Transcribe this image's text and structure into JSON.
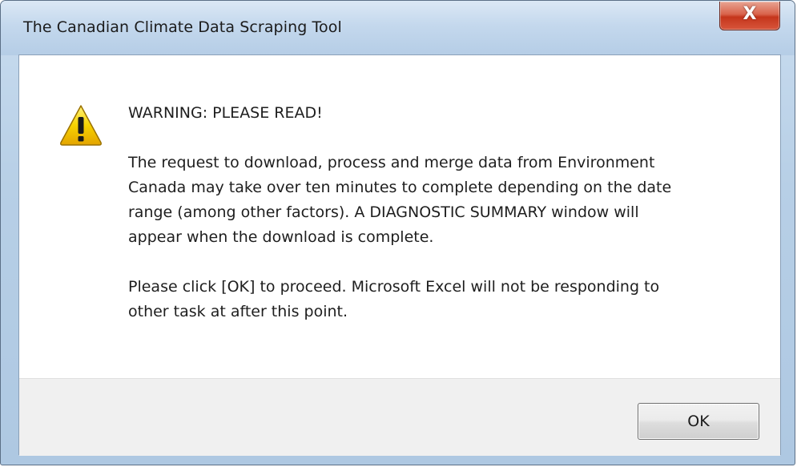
{
  "window": {
    "title": "The Canadian Climate Data Scraping Tool",
    "close_label": "X"
  },
  "dialog": {
    "icon": "warning-icon",
    "heading": "WARNING: PLEASE READ!",
    "paragraph_1_lines": [
      "The request to download, process and merge data from Environment",
      "Canada may take over ten minutes to complete depending on the date",
      "range (among other factors). A DIAGNOSTIC SUMMARY window will",
      "appear when the download is complete."
    ],
    "paragraph_2_lines": [
      "Please click [OK] to proceed. Microsoft Excel will not be responding to",
      "other task at after this point."
    ],
    "ok_label": "OK"
  },
  "colors": {
    "warning_yellow": "#f5c400",
    "close_red": "#c5351c",
    "frame_blue": "#b7cfe6"
  }
}
